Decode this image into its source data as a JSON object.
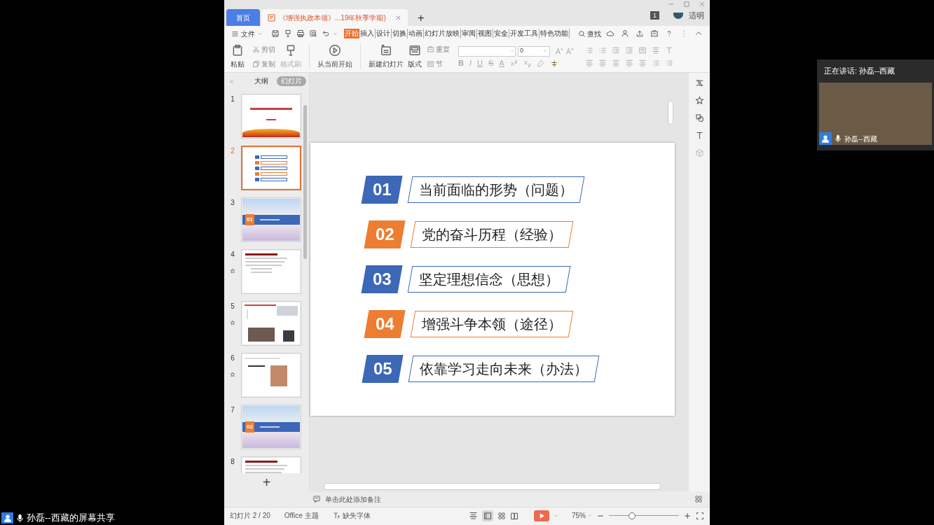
{
  "screen_share": {
    "caption": "孙磊--西藏的屏幕共享"
  },
  "window": {
    "tabs": [
      {
        "label": "首页",
        "kind": "home",
        "selected": false
      },
      {
        "label": "《增强执政本领》...19年秋季学期)",
        "kind": "document",
        "selected": true
      }
    ],
    "new_tab": "+",
    "notification_count": "1",
    "user": "适明"
  },
  "menu": {
    "file": "文件",
    "ribbon_tabs": [
      {
        "label": "开始",
        "selected": true
      },
      {
        "label": "插入",
        "selected": false
      },
      {
        "label": "设计",
        "selected": false
      },
      {
        "label": "切换",
        "selected": false
      },
      {
        "label": "动画",
        "selected": false
      },
      {
        "label": "幻灯片放映",
        "selected": false
      },
      {
        "label": "审阅",
        "selected": false
      },
      {
        "label": "视图",
        "selected": false
      },
      {
        "label": "安全",
        "selected": false
      },
      {
        "label": "开发工具",
        "selected": false
      },
      {
        "label": "特色功能",
        "selected": false
      }
    ],
    "search": "查找"
  },
  "ribbon": {
    "paste": "粘贴",
    "cut": "剪切",
    "copy": "复制",
    "format_painter": "格式刷",
    "play_from_current": "从当前开始",
    "new_slide": "新建幻灯片",
    "layout": "版式",
    "reset": "重置",
    "section": "节",
    "font_size": "0",
    "format_buttons": [
      "B",
      "I",
      "U",
      "S",
      "A"
    ]
  },
  "panel": {
    "tabs": [
      {
        "label": "大纲",
        "selected": false
      },
      {
        "label": "幻灯片",
        "selected": true
      }
    ],
    "thumbnails": [
      {
        "number": "1",
        "kind": "title",
        "selected": false,
        "animated": false
      },
      {
        "number": "2",
        "kind": "agenda",
        "selected": true,
        "animated": false
      },
      {
        "number": "3",
        "kind": "section",
        "badge": "01",
        "selected": false,
        "animated": false
      },
      {
        "number": "4",
        "kind": "text",
        "selected": false,
        "animated": true
      },
      {
        "number": "5",
        "kind": "photos",
        "selected": false,
        "animated": true
      },
      {
        "number": "6",
        "kind": "photo_text",
        "selected": false,
        "animated": true
      },
      {
        "number": "7",
        "kind": "section",
        "badge": "02",
        "selected": false,
        "animated": false
      },
      {
        "number": "8",
        "kind": "text",
        "selected": false,
        "animated": false
      }
    ],
    "add": "+"
  },
  "slide": {
    "items": [
      {
        "number": "01",
        "label": "当前面临的形势（问题）",
        "color": "#3d67b7"
      },
      {
        "number": "02",
        "label": "党的奋斗历程（经验）",
        "color": "#ed7d31"
      },
      {
        "number": "03",
        "label": "坚定理想信念（思想）",
        "color": "#3d67b7"
      },
      {
        "number": "04",
        "label": "增强斗争本领（途径）",
        "color": "#ed7d31"
      },
      {
        "number": "05",
        "label": "依靠学习走向未来（办法）",
        "color": "#3d67b7"
      }
    ]
  },
  "notes": {
    "placeholder": "单击此处添加备注"
  },
  "status_bar": {
    "slide": "幻灯片 2 / 20",
    "theme": "Office 主题",
    "missing_fonts": "缺失字体",
    "zoom": "75%",
    "zoom_slider": {
      "level": 0.33
    }
  },
  "video": {
    "speaking": "正在讲话: 孙磊--西藏",
    "name": "孙磊--西藏"
  }
}
